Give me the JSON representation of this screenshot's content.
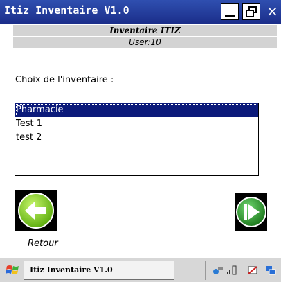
{
  "window": {
    "title": "Itiz Inventaire V1.0",
    "close_glyph": "×"
  },
  "header": {
    "line1": "Inventaire ITIZ",
    "line2": "User:10"
  },
  "main": {
    "label": "Choix de l'inventaire :",
    "list_items": [
      "Pharmacie",
      "Test 1",
      "test 2"
    ],
    "selected_index": 0,
    "back_label": "Retour"
  },
  "taskbar": {
    "task_label": "Itiz Inventaire V1.0"
  },
  "colors": {
    "titlebar": "#1f3597",
    "selection": "#0b1a7a",
    "header_bg": "#d3d3d3",
    "back_green": "#7fd420",
    "next_green": "#2f8f2f"
  },
  "icons": {
    "start": "windows-flag-icon",
    "back": "arrow-left-icon",
    "next": "play-next-icon",
    "tray": [
      "connectivity-icon",
      "signal-icon",
      "sync-icon",
      "screen-icon"
    ]
  }
}
